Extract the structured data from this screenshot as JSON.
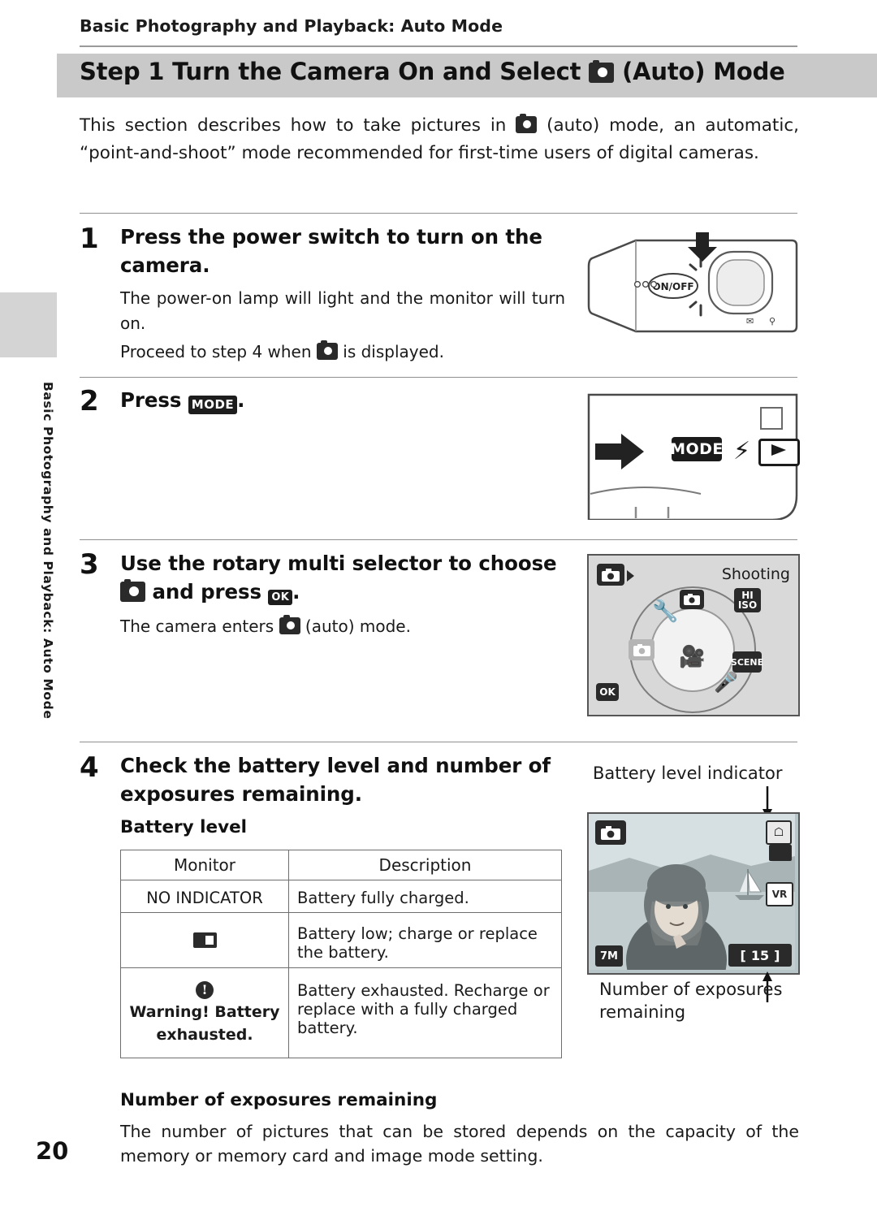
{
  "header": {
    "running_head": "Basic Photography and Playback: Auto Mode",
    "title_prefix": "Step 1 Turn the Camera On and Select",
    "title_suffix": "(Auto) Mode",
    "side_tab_text": "Basic Photography and Playback: Auto Mode"
  },
  "intro": {
    "part1": "This section describes how to take pictures in",
    "part2": "(auto) mode, an automatic, “point-and-shoot” mode recommended for first-time users of digital cameras."
  },
  "steps": [
    {
      "number": "1",
      "title": "Press the power switch to turn on the camera.",
      "body1": "The power-on lamp will light and the monitor will turn on.",
      "body2_prefix": "Proceed to step 4 when",
      "body2_suffix": "is displayed.",
      "figure": {
        "on_off_label": "ON/OFF"
      }
    },
    {
      "number": "2",
      "title_prefix": "Press",
      "title_icon": "MODE",
      "title_suffix": ".",
      "figure": {
        "mode_label": "MODE"
      }
    },
    {
      "number": "3",
      "title_line1": "Use the rotary multi selector to choose",
      "title_line2_mid": "and press",
      "title_ok": "OK",
      "body": "The camera enters",
      "body_suffix": "(auto) mode.",
      "figure": {
        "screen_title": "Shooting",
        "items": [
          "HI ISO",
          "SCENE"
        ],
        "ok_label": "OK"
      }
    },
    {
      "number": "4",
      "title": "Check the battery level and number of exposures remaining.",
      "subhead_battery": "Battery level",
      "subhead_exposures": "Number of exposures remaining",
      "closing_text": "The number of pictures that can be stored depends on the capacity of the memory or memory card and image mode setting."
    }
  ],
  "table": {
    "headers": [
      "Monitor",
      "Description"
    ],
    "rows": [
      {
        "monitor_text": "NO INDICATOR",
        "monitor_icon": "",
        "description": "Battery fully charged."
      },
      {
        "monitor_text": "",
        "monitor_icon": "battery-low-icon",
        "description": "Battery low; charge or replace the battery."
      },
      {
        "monitor_text": "Warning! Battery exhausted.",
        "monitor_icon": "warning-icon",
        "description": "Battery exhausted. Recharge or replace with a fully charged battery."
      }
    ]
  },
  "monitor_figure": {
    "label_battery": "Battery level indicator",
    "label_exposures_line1": "Number of exposures",
    "label_exposures_line2": "remaining",
    "image_mode": "7M",
    "exposure_count": "15",
    "bracket_left": "[",
    "bracket_right": "]"
  },
  "footer": {
    "page_number": "20"
  },
  "colors": {
    "title_bar": "#c9c9c9",
    "side_tab": "#d4d4d4",
    "rule": "#8f8f8f",
    "text": "#1a1a1a"
  }
}
